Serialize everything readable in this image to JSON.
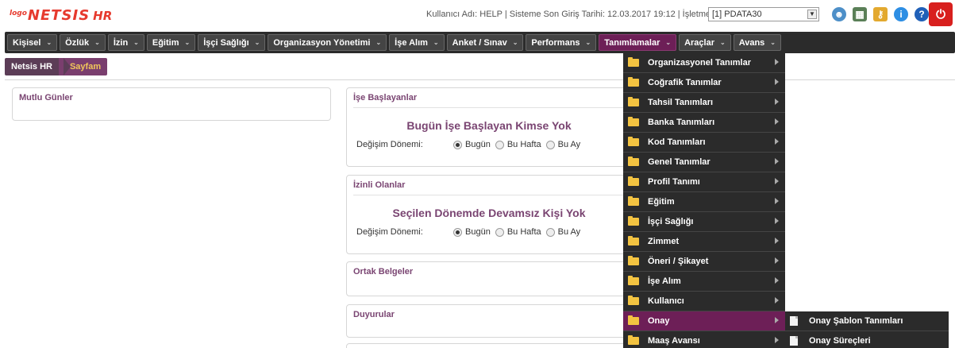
{
  "header": {
    "logo_small": "logo",
    "logo_main": "NETSIS",
    "logo_hr": "HR",
    "user_info": "Kullanıcı Adı: HELP | Sisteme Son Giriş Tarihi: 12.03.2017 19:12 | İşletme:",
    "company_value": "[1] PDATA30",
    "icons": [
      "users-icon",
      "chart-icon",
      "keys-icon",
      "info-icon",
      "help-icon",
      "power-icon"
    ]
  },
  "nav": {
    "items": [
      {
        "label": "Kişisel"
      },
      {
        "label": "Özlük"
      },
      {
        "label": "İzin"
      },
      {
        "label": "Eğitim"
      },
      {
        "label": "İşçi Sağlığı"
      },
      {
        "label": "Organizasyon Yönetimi"
      },
      {
        "label": "İşe Alım"
      },
      {
        "label": "Anket / Sınav"
      },
      {
        "label": "Performans"
      },
      {
        "label": "Tanımlamalar"
      },
      {
        "label": "Araçlar"
      },
      {
        "label": "Avans"
      }
    ],
    "active_index": 9
  },
  "breadcrumb": {
    "first": "Netsis HR",
    "second": "Sayfam"
  },
  "panels": {
    "mutlu": {
      "title": "Mutlu Günler"
    },
    "ise_baslayanlar": {
      "title": "İşe Başlayanlar",
      "headline": "Bugün İşe Başlayan Kimse Yok",
      "period_label": "Değişim Dönemi:",
      "options": [
        "Bugün",
        "Bu Hafta",
        "Bu Ay"
      ],
      "selected": "Bugün"
    },
    "izinli": {
      "title": "İzinli Olanlar",
      "headline": "Seçilen Dönemde Devamsız Kişi Yok",
      "period_label": "Değişim Dönemi:",
      "options": [
        "Bugün",
        "Bu Hafta",
        "Bu Ay"
      ],
      "selected": "Bugün"
    },
    "ortak": {
      "title": "Ortak Belgeler"
    },
    "duyurular": {
      "title": "Duyurular"
    }
  },
  "menu": {
    "items": [
      {
        "label": "Organizasyonel Tanımlar"
      },
      {
        "label": "Coğrafik Tanımlar"
      },
      {
        "label": "Tahsil Tanımları"
      },
      {
        "label": "Banka Tanımları"
      },
      {
        "label": "Kod Tanımları"
      },
      {
        "label": "Genel Tanımlar"
      },
      {
        "label": "Profil Tanımı"
      },
      {
        "label": "Eğitim"
      },
      {
        "label": "İşçi Sağlığı"
      },
      {
        "label": "Zimmet"
      },
      {
        "label": "Öneri / Şikayet"
      },
      {
        "label": "İşe Alım"
      },
      {
        "label": "Kullanıcı"
      },
      {
        "label": "Onay"
      },
      {
        "label": "Maaş Avansı"
      }
    ],
    "active_index": 13
  },
  "submenu": {
    "items": [
      {
        "label": "Onay Şablon Tanımları"
      },
      {
        "label": "Onay Süreçleri"
      }
    ]
  }
}
